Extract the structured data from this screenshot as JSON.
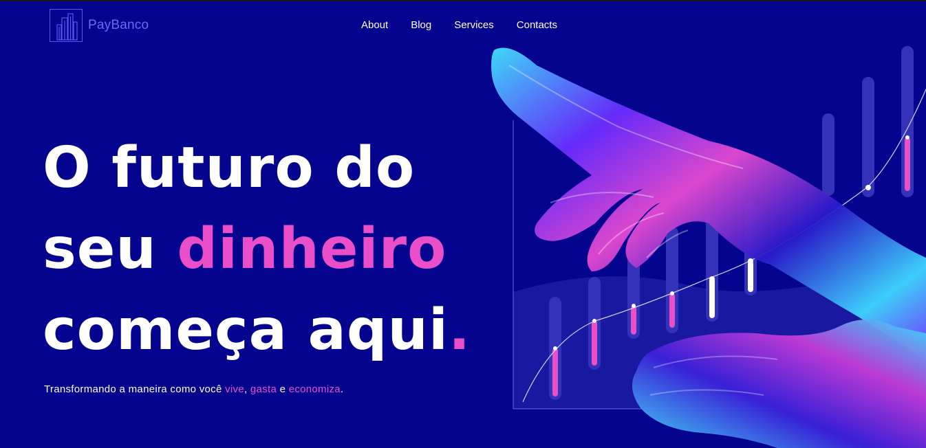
{
  "brand": {
    "name": "PayBanco"
  },
  "nav": {
    "items": [
      "About",
      "Blog",
      "Services",
      "Contacts"
    ]
  },
  "hero": {
    "line1": "O futuro do",
    "line2_prefix": "seu ",
    "line2_highlight": "dinheiro",
    "line3": "começa aqui",
    "line3_dot": "."
  },
  "tagline": {
    "prefix": "Transformando a maneira como você ",
    "word1": "vive",
    "sep1": ", ",
    "word2": "gasta",
    "sep2": " e ",
    "word3": "economiza",
    "suffix": "."
  },
  "colors": {
    "background": "#05048e",
    "accent": "#ea4fc9",
    "brand": "#6d67ff"
  },
  "illustration": {
    "icon": "holographic-hand-chart-illustration"
  }
}
